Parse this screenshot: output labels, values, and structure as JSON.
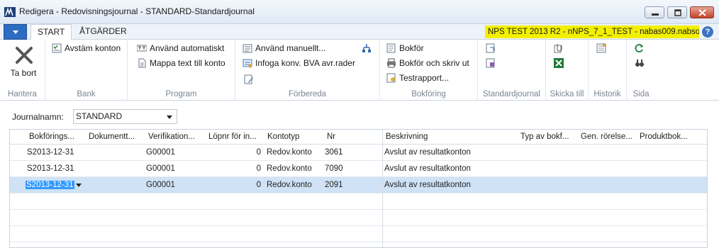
{
  "window": {
    "title": "Redigera - Redovisningsjournal - STANDARD-Standardjournal",
    "app_icon": "dynamics-nav-icon"
  },
  "tabs": [
    {
      "label": "START",
      "active": true
    },
    {
      "label": "ÅTGÄRDER",
      "active": false
    }
  ],
  "environment_badge": "NPS TEST 2013 R2 - nNPS_7_1_TEST - nabas009.nabso...",
  "help_label": "?",
  "ribbon": {
    "hantera": {
      "label": "Hantera",
      "delete_label": "Ta bort"
    },
    "bank": {
      "label": "Bank",
      "reconcile_label": "Avstäm konton"
    },
    "program": {
      "label": "Program",
      "apply_auto_label": "Använd automatiskt",
      "map_text_label": "Mappa text till konto"
    },
    "forbereda": {
      "label": "Förbereda",
      "apply_manual_label": "Använd manuellt...",
      "insert_vat_label": "Infoga konv. BVA avr.rader"
    },
    "bokforing": {
      "label": "Bokföring",
      "post_label": "Bokför",
      "post_print_label": "Bokför och skriv ut",
      "test_report_label": "Testrapport..."
    },
    "standardjournal": {
      "label": "Standardjournal"
    },
    "skicka_till": {
      "label": "Skicka till"
    },
    "historik": {
      "label": "Historik"
    },
    "sida": {
      "label": "Sida"
    }
  },
  "journal": {
    "label": "Journalnamn:",
    "value": "STANDARD"
  },
  "grid": {
    "columns": [
      "Bokförings...",
      "Dokumentt...",
      "Verifikation...",
      "Löpnr för in...",
      "Kontotyp",
      "Nr",
      "Beskrivning",
      "Typ av bokf...",
      "Gen. rörelse...",
      "Produktbok..."
    ],
    "rows": [
      {
        "date": "S2013-12-31",
        "voucher": "G00001",
        "seq": "0",
        "account_type": "Redov.konto",
        "nr": "3061",
        "description": "Avslut av resultatkonton",
        "selected": false
      },
      {
        "date": "S2013-12-31",
        "voucher": "G00001",
        "seq": "0",
        "account_type": "Redov.konto",
        "nr": "7090",
        "description": "Avslut av resultatkonton",
        "selected": false
      },
      {
        "date": "S2013-12-31",
        "voucher": "G00001",
        "seq": "0",
        "account_type": "Redov.konto",
        "nr": "2091",
        "description": "Avslut av resultatkonton",
        "selected": true
      }
    ]
  },
  "colors": {
    "badge_bg": "#f2f000",
    "selected_row": "#cfe2f6",
    "selection": "#3399ff",
    "app_menu": "#2d6cc2"
  }
}
